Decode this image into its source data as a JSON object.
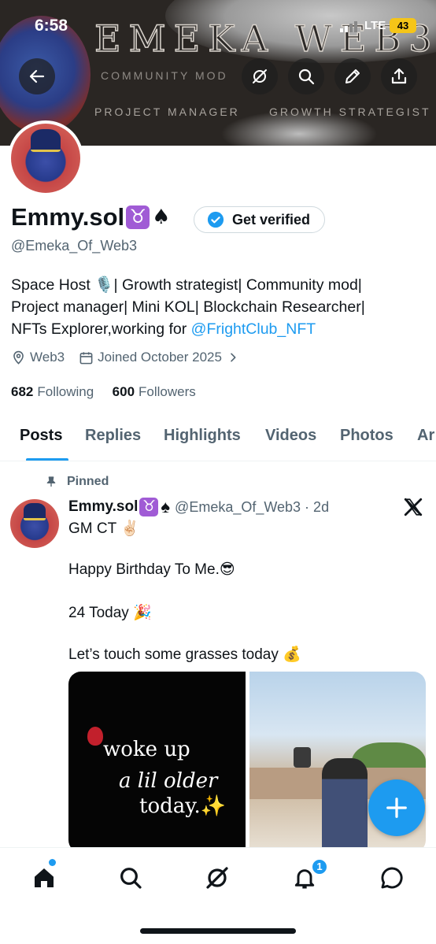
{
  "status_bar": {
    "time": "6:58",
    "network": "LTE",
    "battery": "43"
  },
  "banner": {
    "title": "EMEKA WEB3",
    "sub1": "COMMUNITY MOD",
    "sub2": "PROJECT MANAGER",
    "sub3": "GROWTH STRATEGIST"
  },
  "top_nav": {
    "back_icon": "arrow-left-icon",
    "grok_icon": "grok-icon",
    "search_icon": "search-icon",
    "edit_icon": "pencil-icon",
    "share_icon": "share-icon"
  },
  "profile": {
    "name": "Emmy.sol",
    "name_taurus": "♉",
    "name_spade": "♠",
    "get_verified_label": "Get verified",
    "handle": "@Emeka_Of_Web3",
    "bio_line1": "Space Host 🎙️| Growth strategist| Community mod|",
    "bio_line2": "Project manager| Mini KOL| Blockchain Researcher|",
    "bio_line3_prefix": "NFTs Explorer,working for ",
    "bio_link": "@FrightClub_NFT",
    "location": "Web3",
    "joined": "Joined October 2025",
    "following_count": "682",
    "following_label": "Following",
    "followers_count": "600",
    "followers_label": "Followers"
  },
  "tabs": [
    {
      "label": "Posts",
      "active": true
    },
    {
      "label": "Replies",
      "active": false
    },
    {
      "label": "Highlights",
      "active": false
    },
    {
      "label": "Videos",
      "active": false
    },
    {
      "label": "Photos",
      "active": false
    },
    {
      "label": "Ar",
      "active": false
    }
  ],
  "post": {
    "pinned_label": "Pinned",
    "author_name": "Emmy.sol",
    "author_taurus": "♉",
    "author_spade": "♠",
    "handle_time": "@Emeka_Of_Web3 · 2d",
    "lines": [
      "GM CT ✌🏻",
      "Happy Birthday To Me.😎",
      "24 Today 🎉",
      "Let’s touch some grasses today 💰"
    ],
    "image_text_1": "woke up",
    "image_text_2": "a lil older",
    "image_text_3": "today.✨"
  },
  "bottom_nav": {
    "home_icon": "home-icon",
    "search_icon": "search-icon",
    "grok_icon": "grok-icon",
    "notifications_icon": "bell-icon",
    "notifications_badge": "1",
    "messages_icon": "chat-bubble-icon"
  },
  "colors": {
    "accent": "#1d9bf0",
    "text": "#0f1419",
    "muted": "#536471"
  }
}
